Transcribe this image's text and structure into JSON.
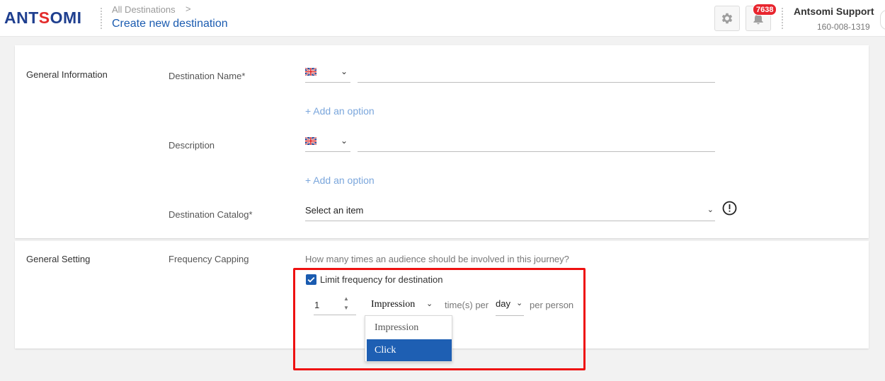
{
  "header": {
    "logo_text": "ANTSOMI",
    "breadcrumb_parent": "All Destinations",
    "breadcrumb_chevron": ">",
    "page_title": "Create new destination",
    "notification_count": "7638",
    "user_name": "Antsomi Support",
    "user_id": "160-008-1319"
  },
  "general_information": {
    "section_label": "General Information",
    "destination_name_label": "Destination Name*",
    "description_label": "Description",
    "add_option": "+ Add an option",
    "catalog_label": "Destination Catalog*",
    "catalog_placeholder": "Select an item",
    "language_flag": "uk-flag",
    "caret": "⌄"
  },
  "general_setting": {
    "section_label": "General Setting",
    "frequency_label": "Frequency Capping",
    "question": "How many times an audience should be involved in this journey?",
    "checkbox_label": "Limit frequency for destination",
    "checkbox_checked": true,
    "count_value": "1",
    "type_selected": "Impression",
    "times_per_text": "time(s) per",
    "period_selected": "day",
    "per_person_text": "per person",
    "dropdown_options": [
      "Impression",
      "Click"
    ],
    "dropdown_highlighted": "Click"
  },
  "colors": {
    "primary": "#1a5bb0",
    "link": "#7aa6dc",
    "badge": "#e8252e",
    "highlight_box": "#ee1111"
  },
  "icons": {
    "settings": "gear-icon",
    "notifications": "bell-icon",
    "catalog_info": "alert-circle-icon"
  }
}
